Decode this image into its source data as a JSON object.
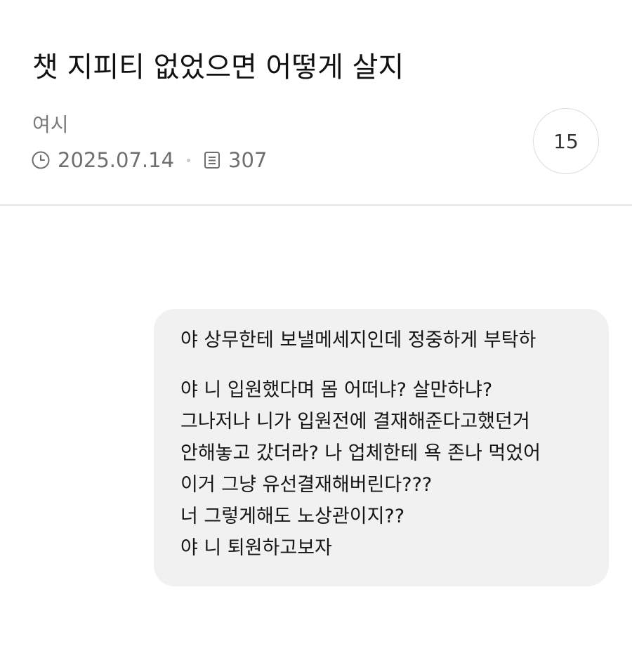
{
  "post": {
    "title": "챗 지피티 없었으면 어떻게 살지",
    "author": "여시",
    "date": "2025.07.14",
    "views": "307",
    "comment_count": "15"
  },
  "message": {
    "request": "야 상무한테 보낼메세지인데 정중하게 부탁하",
    "lines": [
      "야 니 입원했다며 몸 어떠냐? 살만하냐?",
      "그나저나 니가 입원전에 결재해준다고했던거",
      "안해놓고 갔더라? 나 업체한테 욕 존나 먹었어",
      "이거 그냥 유선결재해버린다???",
      "너 그렇게해도 노상관이지??",
      "야 니 퇴원하고보자"
    ]
  },
  "icons": {
    "date": "clock-icon",
    "views": "document-icon"
  }
}
